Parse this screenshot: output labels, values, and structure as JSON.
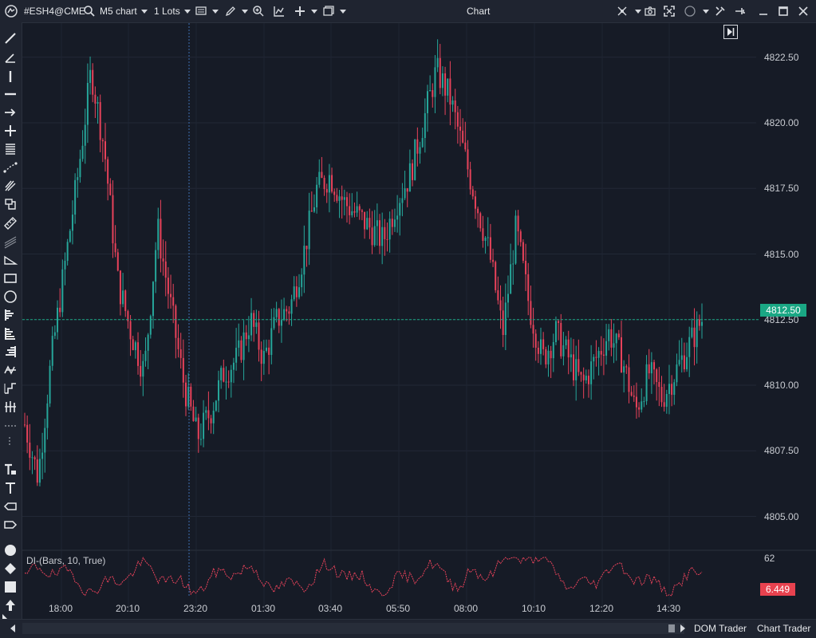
{
  "titlebar": {
    "symbol": "#ESH4@CME",
    "timeframe": "M5 chart",
    "lots": "1 Lots",
    "window_title": "Chart"
  },
  "price_axis": {
    "labels": [
      "4822.50",
      "4820.00",
      "4817.50",
      "4815.00",
      "4812.50",
      "4810.00",
      "4807.50",
      "4805.00"
    ],
    "current_price": "4812.50"
  },
  "time_axis": {
    "labels": [
      "18:00",
      "20:10",
      "23:20",
      "01:30",
      "03:40",
      "05:50",
      "08:00",
      "10:10",
      "12:20",
      "14:30"
    ]
  },
  "indicator": {
    "label": "DI-(Bars, 10, True)",
    "max_label": "62",
    "current_value": "6.449"
  },
  "bottombar": {
    "dom_trader": "DOM Trader",
    "chart_trader": "Chart Trader"
  },
  "colors": {
    "up": "#26a69a",
    "down": "#e8425a",
    "background": "#161b26",
    "indicator_line": "#e8425a"
  },
  "chart_data": {
    "type": "candlestick",
    "title": "",
    "ylim": [
      4803.8,
      4823.8
    ],
    "series_close_approx": [
      4808.5,
      4806.5,
      4811.0,
      4814.5,
      4818.0,
      4822.0,
      4819.0,
      4814.0,
      4812.0,
      4810.5,
      4816.0,
      4813.0,
      4810.0,
      4808.0,
      4809.0,
      4810.5,
      4811.0,
      4812.5,
      4811.0,
      4812.5,
      4813.0,
      4815.0,
      4817.5,
      4818.0,
      4817.0,
      4816.5,
      4816.0,
      4815.5,
      4817.0,
      4818.0,
      4820.0,
      4822.0,
      4821.0,
      4819.0,
      4817.0,
      4815.0,
      4812.0,
      4816.0,
      4813.0,
      4811.0,
      4812.0,
      4811.0,
      4810.0,
      4811.0,
      4812.0,
      4811.0,
      4809.0,
      4810.5,
      4809.5,
      4810.5,
      4811.5,
      4812.5
    ],
    "indicator": {
      "name": "DI-(Bars, 10, True)",
      "current": 6.449,
      "axis_max": 62
    }
  }
}
